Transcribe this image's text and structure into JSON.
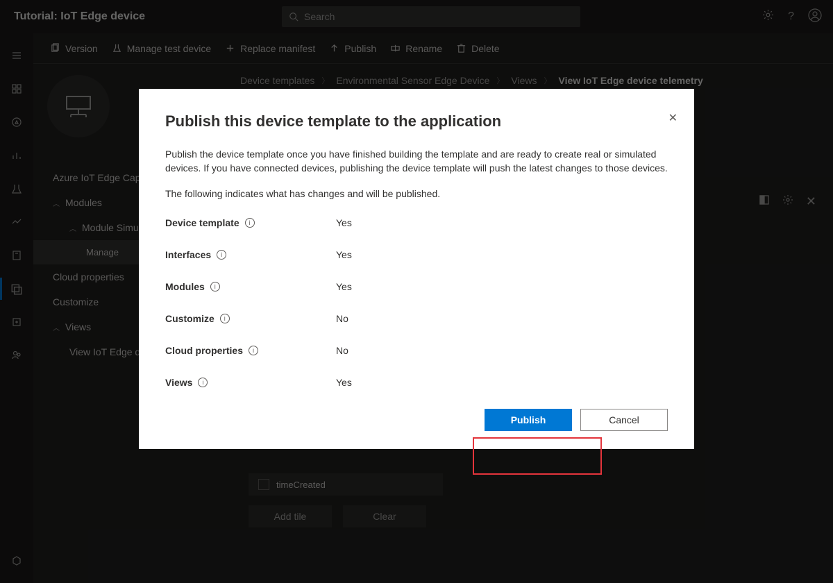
{
  "topbar": {
    "title": "Tutorial: IoT Edge device",
    "search_placeholder": "Search"
  },
  "cmdbar": {
    "version": "Version",
    "manage_test": "Manage test device",
    "replace": "Replace manifest",
    "publish": "Publish",
    "rename": "Rename",
    "delete": "Delete"
  },
  "breadcrumbs": {
    "b1": "Device templates",
    "b2": "Environmental Sensor Edge Device",
    "b3": "Views",
    "b4": "View IoT Edge device telemetry"
  },
  "sidenav": {
    "caps": "Azure IoT Edge Capabilities",
    "modules": "Modules",
    "module_sim": "Module SimulatedTemperatureSensor",
    "manage": "Manage",
    "cloud_props": "Cloud properties",
    "customize": "Customize",
    "views": "Views",
    "view_item": "View IoT Edge device telemetry"
  },
  "tiles": {
    "timeCreated": "timeCreated",
    "add_tile": "Add tile",
    "clear": "Clear"
  },
  "modal": {
    "title": "Publish this device template to the application",
    "desc": "Publish the device template once you have finished building the template and are ready to create real or simulated devices. If you have connected devices, publishing the device template will push the latest changes to those devices.",
    "sub": "The following indicates what has changes and will be published.",
    "rows": [
      {
        "label": "Device template",
        "value": "Yes"
      },
      {
        "label": "Interfaces",
        "value": "Yes"
      },
      {
        "label": "Modules",
        "value": "Yes"
      },
      {
        "label": "Customize",
        "value": "No"
      },
      {
        "label": "Cloud properties",
        "value": "No"
      },
      {
        "label": "Views",
        "value": "Yes"
      }
    ],
    "publish": "Publish",
    "cancel": "Cancel"
  }
}
